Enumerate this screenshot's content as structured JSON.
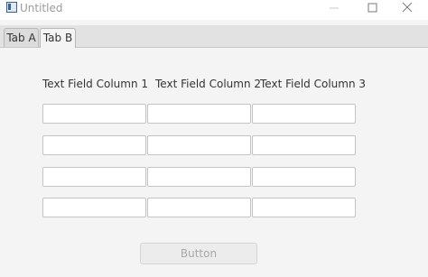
{
  "window": {
    "title": "Untitled"
  },
  "tabs": [
    {
      "label": "Tab A",
      "selected": false
    },
    {
      "label": "Tab B",
      "selected": true
    }
  ],
  "table": {
    "columns": [
      "Text Field Column 1",
      "Text Field Column 2",
      "Text Field Column 3"
    ],
    "rows": [
      [
        "",
        "",
        ""
      ],
      [
        "",
        "",
        ""
      ],
      [
        "",
        "",
        ""
      ],
      [
        "",
        "",
        ""
      ]
    ]
  },
  "button": {
    "label": "Button",
    "enabled": false
  },
  "colors": {
    "background": "#f4f4f4",
    "tab_header": "#e2e2e2",
    "title_text": "#9a9a9a",
    "disabled_button_text": "#a8a8a8"
  }
}
